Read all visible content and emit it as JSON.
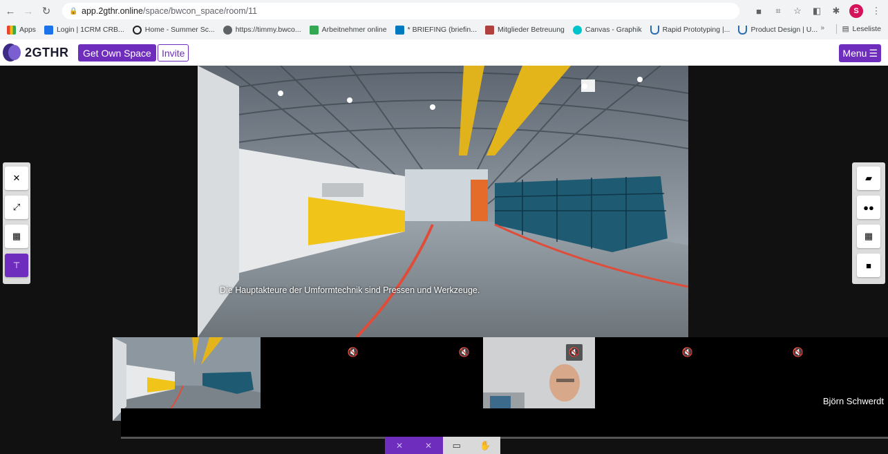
{
  "browser": {
    "url_host": "app.2gthr.online",
    "url_path": "/space/bwcon_space/room/11",
    "profile_initial": "S",
    "bookmarks": [
      {
        "label": "Apps",
        "color": "#ea4335"
      },
      {
        "label": "Login | 1CRM CRB...",
        "color": "#1a73e8"
      },
      {
        "label": "Home - Summer Sc...",
        "color": "#202124"
      },
      {
        "label": "https://timmy.bwco...",
        "color": "#5f6368"
      },
      {
        "label": "Arbeitnehmer online",
        "color": "#34a853"
      },
      {
        "label": "* BRIEFING (briefin...",
        "color": "#0079bf"
      },
      {
        "label": "Mitglieder Betreuung",
        "color": "#b0413e"
      },
      {
        "label": "Canvas - Graphik",
        "color": "#00c4cc"
      },
      {
        "label": "Rapid Prototyping |...",
        "color": "#2b6cb0"
      },
      {
        "label": "Product Design | U...",
        "color": "#2b6cb0"
      }
    ],
    "bookmarks_more": "»",
    "reading_list": "Leseliste"
  },
  "app": {
    "logo_text": "2GTHR",
    "get_own_space": "Get Own Space",
    "invite": "Invite",
    "menu": "Menu",
    "accent_color": "#6f2dbd"
  },
  "main_video": {
    "subtitle": "Die Hauptakteure der Umformtechnik sind Pressen und Werkzeuge."
  },
  "left_toolbar": [
    {
      "name": "close-icon",
      "glyph": "✕"
    },
    {
      "name": "expand-icon",
      "glyph": "⤢"
    },
    {
      "name": "grid-icon",
      "glyph": "▦"
    },
    {
      "name": "pin-icon",
      "glyph": "📌"
    }
  ],
  "right_toolbar": [
    {
      "name": "chat-icon",
      "glyph": "💬"
    },
    {
      "name": "users-icon",
      "glyph": "👥"
    },
    {
      "name": "calendar-icon",
      "glyph": "📅"
    },
    {
      "name": "note-icon",
      "glyph": "▰"
    }
  ],
  "participants": {
    "camera_name": "Björn Schwerdt"
  }
}
